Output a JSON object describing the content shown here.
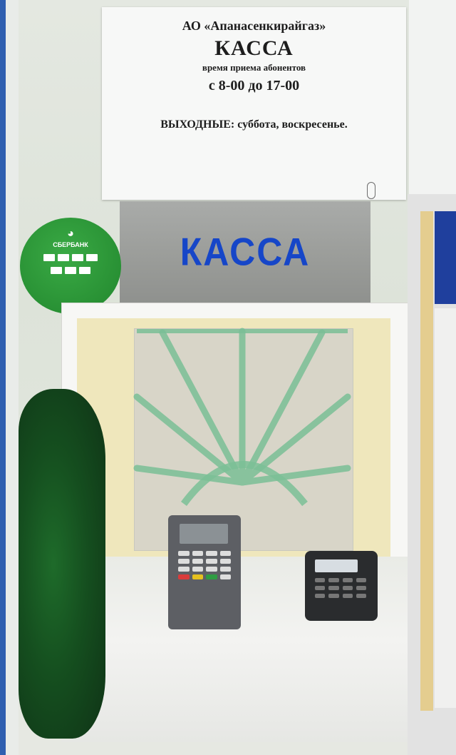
{
  "photo": {
    "paper_sign": {
      "org_line": "АО «Апанасенкирайгаз»",
      "title": "КАССА",
      "time_label": "время приема абонентов",
      "hours": "с 8-00 до 17-00",
      "weekend": "ВЫХОДНЫЕ: суббота, воскресенье."
    },
    "metal_sign": {
      "text": "КАССА",
      "text_color": "#1646c8"
    },
    "sber_sticker": {
      "brand": "СБЕРБАНК",
      "color": "#21862d"
    }
  }
}
